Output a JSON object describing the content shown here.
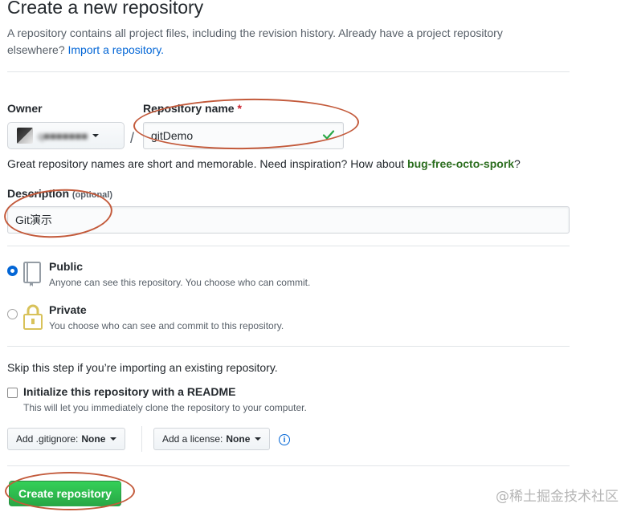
{
  "header": {
    "title": "Create a new repository",
    "description": "A repository contains all project files, including the revision history. Already have a project repository elsewhere?",
    "import_link": "Import a repository."
  },
  "owner": {
    "label": "Owner",
    "name": "q■■■■■■■"
  },
  "separator": "/",
  "repo_name": {
    "label": "Repository name",
    "required_mark": "*",
    "value": "gitDemo"
  },
  "hint": {
    "text": "Great repository names are short and memorable. Need inspiration? How about",
    "suggestion": "bug-free-octo-spork",
    "tail": "?"
  },
  "description_field": {
    "label": "Description",
    "optional": "(optional)",
    "value": "Git演示"
  },
  "visibility": {
    "public": {
      "title": "Public",
      "note": "Anyone can see this repository. You choose who can commit.",
      "selected": true
    },
    "private": {
      "title": "Private",
      "note": "You choose who can see and commit to this repository.",
      "selected": false
    }
  },
  "init": {
    "skip_note": "Skip this step if you’re importing an existing repository.",
    "readme_label": "Initialize this repository with a README",
    "readme_note": "This will let you immediately clone the repository to your computer.",
    "readme_checked": false
  },
  "gitignore": {
    "label": "Add .gitignore:",
    "value": "None"
  },
  "license": {
    "label": "Add a license:",
    "value": "None"
  },
  "info_icon_glyph": "i",
  "submit": {
    "label": "Create repository"
  },
  "watermark": "@稀土掘金技术社区",
  "colors": {
    "accent": "#0366d6",
    "success": "#28a745",
    "annotation": "#c35a3b"
  }
}
